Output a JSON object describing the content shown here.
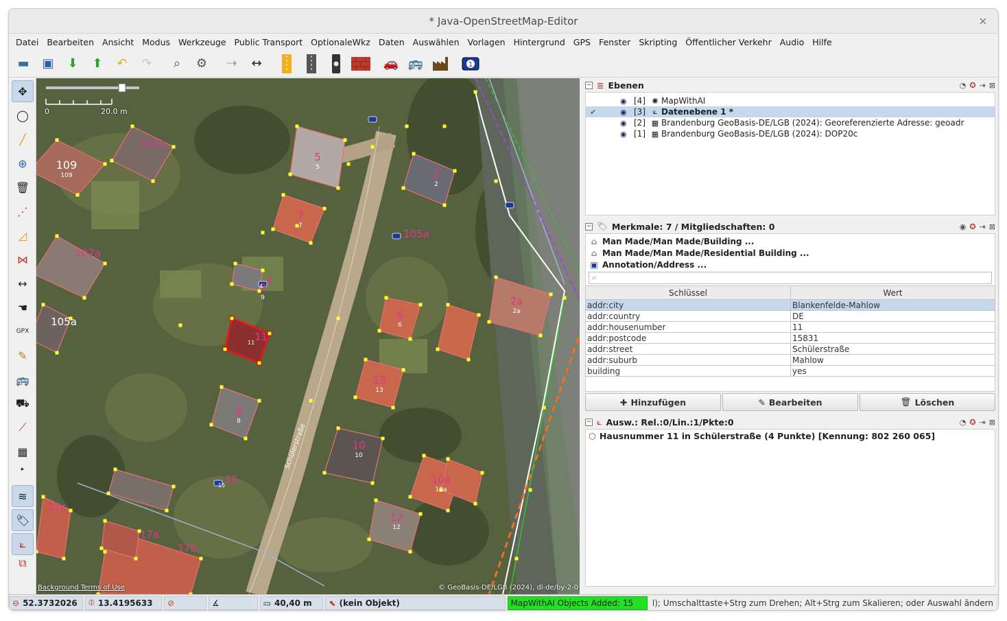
{
  "window": {
    "title": "* Java-OpenStreetMap-Editor",
    "close_glyph": "×"
  },
  "menu": [
    "Datei",
    "Bearbeiten",
    "Ansicht",
    "Modus",
    "Werkzeuge",
    "Public Transport",
    "OptionaleWkz",
    "Daten",
    "Auswählen",
    "Vorlagen",
    "Hintergrund",
    "GPS",
    "Fenster",
    "Skripting",
    "Öffentlicher Verkehr",
    "Audio",
    "Hilfe"
  ],
  "toolbar_icons": [
    "open-icon",
    "save-icon",
    "download-icon",
    "upload-icon",
    "undo-icon",
    "redo-icon",
    "zoom-icon",
    "preferences-icon",
    "merge-nodes-icon",
    "split-way-icon",
    "road-yellow-icon",
    "road-grey-icon",
    "traffic-light-icon",
    "wall-icon",
    "car-icon",
    "bus-icon",
    "factory-icon",
    "address-icon"
  ],
  "left_tools": [
    "select-tool-icon",
    "lasso-tool-icon",
    "draw-tool-icon",
    "zoom-tool-icon",
    "delete-tool-icon",
    "improve-way-icon",
    "parallel-way-icon",
    "split-icon",
    "measure-icon",
    "hand-icon",
    "gpx-icon",
    "pencil-icon",
    "bus-icon",
    "transit-icon",
    "route-icon",
    "building-tool-icon",
    "more-icon"
  ],
  "left_panel_toggles": [
    "layers-toggle-icon",
    "tags-toggle-icon",
    "selection-toggle-icon",
    "relations-toggle-icon"
  ],
  "map": {
    "scale_zero": "0",
    "scale_label": "20.0 m",
    "attribution_left": "Background Terms of Use",
    "attribution_right": "© GeoBasis-DE/LGB (2024), dl-de/by-2-0",
    "street_name": "Schülerstraße",
    "house_labels": [
      {
        "big": "109",
        "small": "109"
      },
      {
        "big": "111a",
        "small": ""
      },
      {
        "big": "107a",
        "small": ""
      },
      {
        "big": "105a",
        "small": ""
      },
      {
        "big": "2",
        "small": "2"
      },
      {
        "big": "7",
        "small": "7"
      },
      {
        "big": "5",
        "small": "5"
      },
      {
        "big": "4",
        "small": "4"
      },
      {
        "big": "9",
        "small": "9"
      },
      {
        "big": "6",
        "small": "6"
      },
      {
        "big": "2a",
        "small": "2a"
      },
      {
        "big": "11",
        "small": "11"
      },
      {
        "big": "13",
        "small": "13"
      },
      {
        "big": "8",
        "small": "8"
      },
      {
        "big": "10",
        "small": "10"
      },
      {
        "big": "10a",
        "small": "10a"
      },
      {
        "big": "15",
        "small": "15"
      },
      {
        "big": "12",
        "small": "12"
      },
      {
        "big": "17c",
        "small": ""
      },
      {
        "big": "17b",
        "small": ""
      },
      {
        "big": "17a",
        "small": ""
      }
    ]
  },
  "layers": {
    "title": "Ebenen",
    "items": [
      {
        "index": "[4]",
        "name": "MapWithAI",
        "selected": false,
        "active": false
      },
      {
        "index": "[3]",
        "name": "Datenebene 1 *",
        "selected": true,
        "active": true
      },
      {
        "index": "[2]",
        "name": "Brandenburg GeoBasis-DE/LGB (2024): Georeferenzierte Adresse: geoadr",
        "selected": false,
        "active": false
      },
      {
        "index": "[1]",
        "name": "Brandenburg GeoBasis-DE/LGB (2024): DOP20c",
        "selected": false,
        "active": false
      }
    ]
  },
  "tags": {
    "title": "Merkmale: 7 / Mitgliedschaften: 0",
    "presets": [
      "Man Made/Man Made/Building ...",
      "Man Made/Man Made/Residential Building ...",
      "Annotation/Address ..."
    ],
    "search_placeholder": "",
    "header_key": "Schlüssel",
    "header_value": "Wert",
    "rows": [
      {
        "key": "addr:city",
        "value": "Blankenfelde-Mahlow"
      },
      {
        "key": "addr:country",
        "value": "DE"
      },
      {
        "key": "addr:housenumber",
        "value": "11"
      },
      {
        "key": "addr:postcode",
        "value": "15831"
      },
      {
        "key": "addr:street",
        "value": "Schülerstraße"
      },
      {
        "key": "addr:suburb",
        "value": "Mahlow"
      },
      {
        "key": "building",
        "value": "yes"
      }
    ],
    "buttons": {
      "add": "Hinzufügen",
      "edit": "Bearbeiten",
      "delete": "Löschen"
    }
  },
  "selection": {
    "title": "Ausw.: Rel.:0/Lin.:1/Pkte:0",
    "items": [
      "Hausnummer 11 in Schülerstraße (4 Punkte) [Kennung: 802 260 065]"
    ]
  },
  "status": {
    "lat": "52.3732026",
    "lon": "13.4195633",
    "heading": "",
    "angle": "",
    "distance": "40,40 m",
    "object": "(kein Objekt)",
    "mapwithai": "MapWithAI Objects Added: 15",
    "help": "l); Umschalttaste+Strg zum Drehen; Alt+Strg zum Skalieren; oder Auswahl ändern"
  },
  "colors": {
    "selection": "#c5d7ec",
    "building_outline": "#e87070",
    "selected_building": "#e01a1a",
    "node": "#ffff30",
    "house_label": "#e0358c",
    "green_status": "#22e022"
  }
}
